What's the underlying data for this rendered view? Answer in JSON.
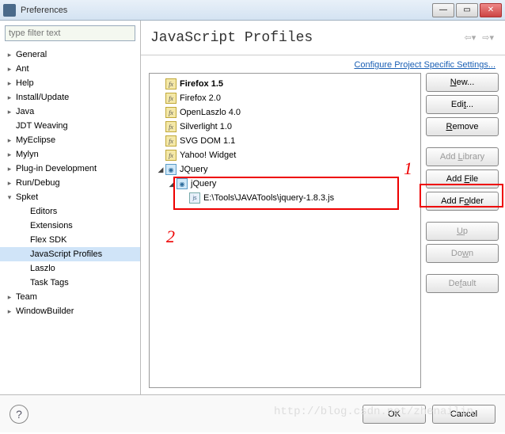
{
  "window": {
    "title": "Preferences"
  },
  "filter": {
    "placeholder": "type filter text"
  },
  "sidebar": {
    "items": [
      {
        "label": "General",
        "indent": 0,
        "expandable": true,
        "expanded": false
      },
      {
        "label": "Ant",
        "indent": 0,
        "expandable": true,
        "expanded": false
      },
      {
        "label": "Help",
        "indent": 0,
        "expandable": true,
        "expanded": false
      },
      {
        "label": "Install/Update",
        "indent": 0,
        "expandable": true,
        "expanded": false
      },
      {
        "label": "Java",
        "indent": 0,
        "expandable": true,
        "expanded": false
      },
      {
        "label": "JDT Weaving",
        "indent": 0,
        "expandable": false
      },
      {
        "label": "MyEclipse",
        "indent": 0,
        "expandable": true,
        "expanded": false
      },
      {
        "label": "Mylyn",
        "indent": 0,
        "expandable": true,
        "expanded": false
      },
      {
        "label": "Plug-in Development",
        "indent": 0,
        "expandable": true,
        "expanded": false
      },
      {
        "label": "Run/Debug",
        "indent": 0,
        "expandable": true,
        "expanded": false
      },
      {
        "label": "Spket",
        "indent": 0,
        "expandable": true,
        "expanded": true
      },
      {
        "label": "Editors",
        "indent": 1,
        "expandable": false
      },
      {
        "label": "Extensions",
        "indent": 1,
        "expandable": false
      },
      {
        "label": "Flex SDK",
        "indent": 1,
        "expandable": false
      },
      {
        "label": "JavaScript Profiles",
        "indent": 1,
        "expandable": false,
        "selected": true
      },
      {
        "label": "Laszlo",
        "indent": 1,
        "expandable": false
      },
      {
        "label": "Task Tags",
        "indent": 1,
        "expandable": false
      },
      {
        "label": "Team",
        "indent": 0,
        "expandable": true,
        "expanded": false
      },
      {
        "label": "WindowBuilder",
        "indent": 0,
        "expandable": true,
        "expanded": false
      }
    ]
  },
  "content": {
    "title": "JavaScript Profiles",
    "configLink": "Configure Project Specific Settings..."
  },
  "profiles": {
    "items": [
      {
        "label": "Firefox 1.5",
        "icon": "fx",
        "indent": 0,
        "bold": true
      },
      {
        "label": "Firefox 2.0",
        "icon": "fx",
        "indent": 0
      },
      {
        "label": "OpenLaszlo 4.0",
        "icon": "fx",
        "indent": 0
      },
      {
        "label": "Silverlight 1.0",
        "icon": "fx",
        "indent": 0
      },
      {
        "label": "SVG DOM 1.1",
        "icon": "fx",
        "indent": 0
      },
      {
        "label": "Yahoo! Widget",
        "icon": "fx",
        "indent": 0
      },
      {
        "label": "JQuery",
        "icon": "jq",
        "indent": 0,
        "expanded": true
      },
      {
        "label": "jQuery",
        "icon": "jq",
        "indent": 1,
        "expanded": true
      },
      {
        "label": "E:\\Tools\\JAVATools\\jquery-1.8.3.js",
        "icon": "file",
        "indent": 2
      }
    ]
  },
  "buttons": {
    "new": "New...",
    "edit": "Edit...",
    "remove": "Remove",
    "addLibrary": "Add Library",
    "addFile": "Add File",
    "addFolder": "Add Folder",
    "up": "Up",
    "down": "Down",
    "default": "Default"
  },
  "footer": {
    "ok": "OK",
    "cancel": "Cancel"
  },
  "annotations": {
    "one": "1",
    "two": "2"
  },
  "watermark": "http://blog.csdn.net/zhenailin"
}
